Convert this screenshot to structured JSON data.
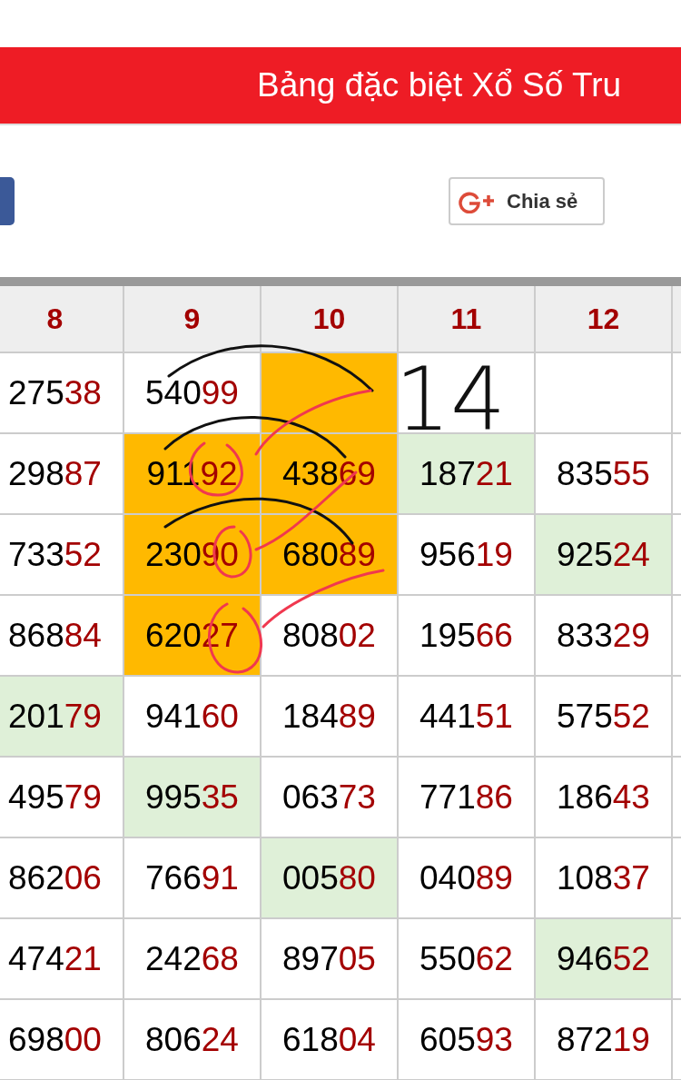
{
  "banner": {
    "title": "Bảng đặc biệt Xổ Số Tru"
  },
  "share_button": {
    "label": "Chia sẻ"
  },
  "table": {
    "columns": [
      "8",
      "9",
      "10",
      "11",
      "12"
    ],
    "rows": [
      [
        {
          "value": "27538",
          "color": "#ffffff"
        },
        {
          "value": "54099",
          "color": "#ffffff"
        },
        {
          "color": "#ffb900"
        },
        {
          "color": "#ffffff"
        },
        {
          "color": "#ffffff"
        }
      ],
      [
        {
          "value": "29887",
          "color": "#ffffff"
        },
        {
          "value": "91192",
          "color": "#ffb900"
        },
        {
          "value": "43869",
          "color": "#ffb900"
        },
        {
          "value": "18721",
          "color": "#dff0d8"
        },
        {
          "value": "83555",
          "color": "#ffffff"
        }
      ],
      [
        {
          "value": "73352",
          "color": "#ffffff"
        },
        {
          "value": "23090",
          "color": "#ffb900"
        },
        {
          "value": "68089",
          "color": "#ffb900"
        },
        {
          "value": "95619",
          "color": "#ffffff"
        },
        {
          "value": "92524",
          "color": "#dff0d8"
        }
      ],
      [
        {
          "value": "86884",
          "color": "#ffffff"
        },
        {
          "value": "62027",
          "color": "#ffb900"
        },
        {
          "value": "80802",
          "color": "#ffffff"
        },
        {
          "value": "19566",
          "color": "#ffffff"
        },
        {
          "value": "83329",
          "color": "#ffffff"
        }
      ],
      [
        {
          "value": "20179",
          "color": "#dff0d8"
        },
        {
          "value": "94160",
          "color": "#ffffff"
        },
        {
          "value": "18489",
          "color": "#ffffff"
        },
        {
          "value": "44151",
          "color": "#ffffff"
        },
        {
          "value": "57552",
          "color": "#ffffff"
        }
      ],
      [
        {
          "value": "49579",
          "color": "#ffffff"
        },
        {
          "value": "99535",
          "color": "#dff0d8"
        },
        {
          "value": "06373",
          "color": "#ffffff"
        },
        {
          "value": "77186",
          "color": "#ffffff"
        },
        {
          "value": "18643",
          "color": "#ffffff"
        }
      ],
      [
        {
          "value": "86206",
          "color": "#ffffff"
        },
        {
          "value": "76691",
          "color": "#ffffff"
        },
        {
          "value": "00580",
          "color": "#dff0d8"
        },
        {
          "value": "04089",
          "color": "#ffffff"
        },
        {
          "value": "10837",
          "color": "#ffffff"
        }
      ],
      [
        {
          "value": "47421",
          "color": "#ffffff"
        },
        {
          "value": "24268",
          "color": "#ffffff"
        },
        {
          "value": "89705",
          "color": "#ffffff"
        },
        {
          "value": "55062",
          "color": "#ffffff"
        },
        {
          "value": "94652",
          "color": "#dff0d8"
        }
      ],
      [
        {
          "value": "69800",
          "color": "#ffffff"
        },
        {
          "value": "80624",
          "color": "#ffffff"
        },
        {
          "value": "61804",
          "color": "#ffffff"
        },
        {
          "value": "60593",
          "color": "#ffffff"
        },
        {
          "value": "87219",
          "color": "#ffffff"
        }
      ]
    ]
  },
  "annotation": {
    "text": "14"
  }
}
